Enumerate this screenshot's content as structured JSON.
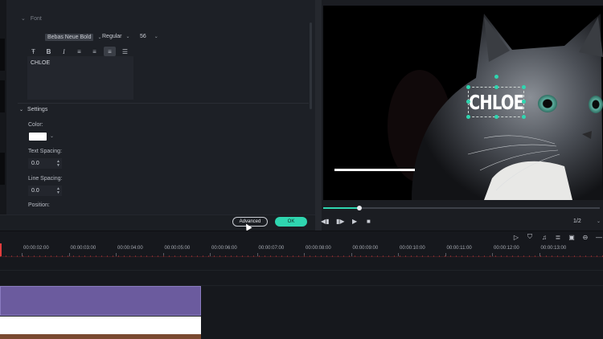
{
  "editor": {
    "font_section_label": "Font",
    "font_family": "Bebas Neue Bold",
    "font_weight": "Regular",
    "font_size": "56",
    "text_content": "CHLOE",
    "settings_label": "Settings",
    "color_label": "Color:",
    "color_value": "#ffffff",
    "text_spacing_label": "Text Spacing:",
    "text_spacing_value": "0.0",
    "line_spacing_label": "Line Spacing:",
    "line_spacing_value": "0.0",
    "position_label": "Position:",
    "advanced_button": "Advanced",
    "ok_button": "OK"
  },
  "preview": {
    "title_text": "CHLOE",
    "progress": 0.13,
    "page_indicator": "1/2"
  },
  "timeline": {
    "ticks": [
      "00:00:02:00",
      "00:00:03:00",
      "00:00:04:00",
      "00:00:05:00",
      "00:00:06:00",
      "00:00:07:00",
      "00:00:08:00",
      "00:00:09:00",
      "00:00:10:00",
      "00:00:11:00",
      "00:00:12:00",
      "00:00:13:00"
    ]
  },
  "colors": {
    "accent": "#2fd6b0",
    "clip_title": "#6b5b9e",
    "playhead": "#e23d3d"
  }
}
